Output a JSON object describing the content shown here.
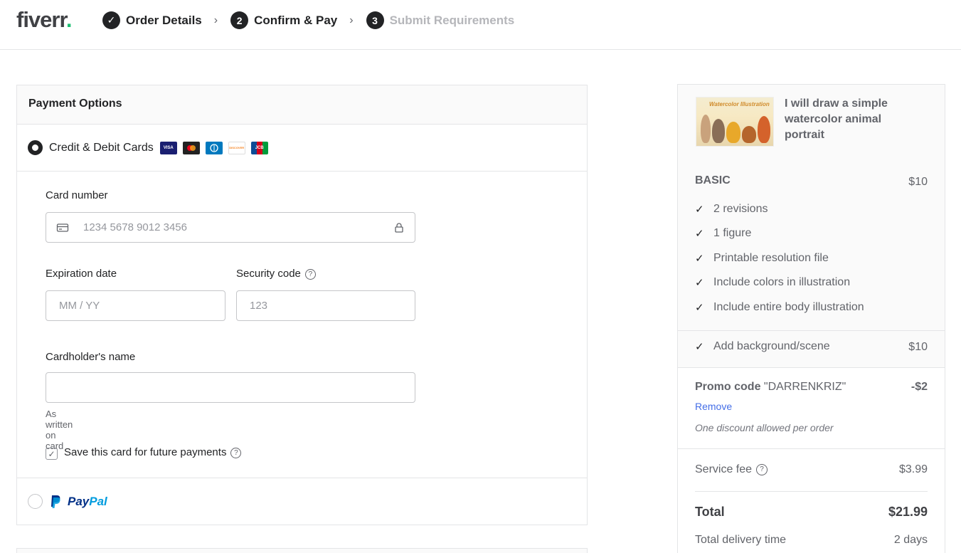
{
  "brand": {
    "name": "fiverr",
    "dot": ".",
    "accent": "#1dbf73"
  },
  "steps": [
    {
      "number": "✓",
      "label": "Order Details"
    },
    {
      "number": "2",
      "label": "Confirm & Pay"
    },
    {
      "number": "3",
      "label": "Submit Requirements"
    }
  ],
  "step_separator": "›",
  "payment": {
    "header": "Payment Options",
    "credit_label": "Credit & Debit Cards",
    "card_brands": [
      "VISA",
      "MC",
      "DC",
      "DISCOVER",
      "JCB"
    ],
    "card_number_label": "Card number",
    "card_number_placeholder": "1234 5678 9012 3456",
    "expiration_label": "Expiration date",
    "expiration_placeholder": "MM / YY",
    "security_label": "Security code",
    "security_placeholder": "123",
    "cardholder_label": "Cardholder's name",
    "cardholder_hint": "As written on card",
    "save_card_label": "Save this card for future payments",
    "save_card_checked": true,
    "paypal_p1": "Pay",
    "paypal_p2": "Pal"
  },
  "summary": {
    "thumb_title": "Watercolor Illustration",
    "gig_title": "I will draw a simple watercolor animal portrait",
    "package_name": "BASIC",
    "package_price": "$10",
    "features": [
      "2 revisions",
      "1 figure",
      "Printable resolution file",
      "Include colors in illustration",
      "Include entire body illustration"
    ],
    "extra_label": "Add background/scene",
    "extra_price": "$10",
    "promo_prefix": "Promo code",
    "promo_code": "\"DARRENKRIZ\"",
    "promo_discount": "-$2",
    "promo_remove": "Remove",
    "promo_note": "One discount allowed per order",
    "service_fee_label": "Service fee",
    "service_fee": "$3.99",
    "total_label": "Total",
    "total": "$21.99",
    "delivery_label": "Total delivery time",
    "delivery": "2 days"
  }
}
